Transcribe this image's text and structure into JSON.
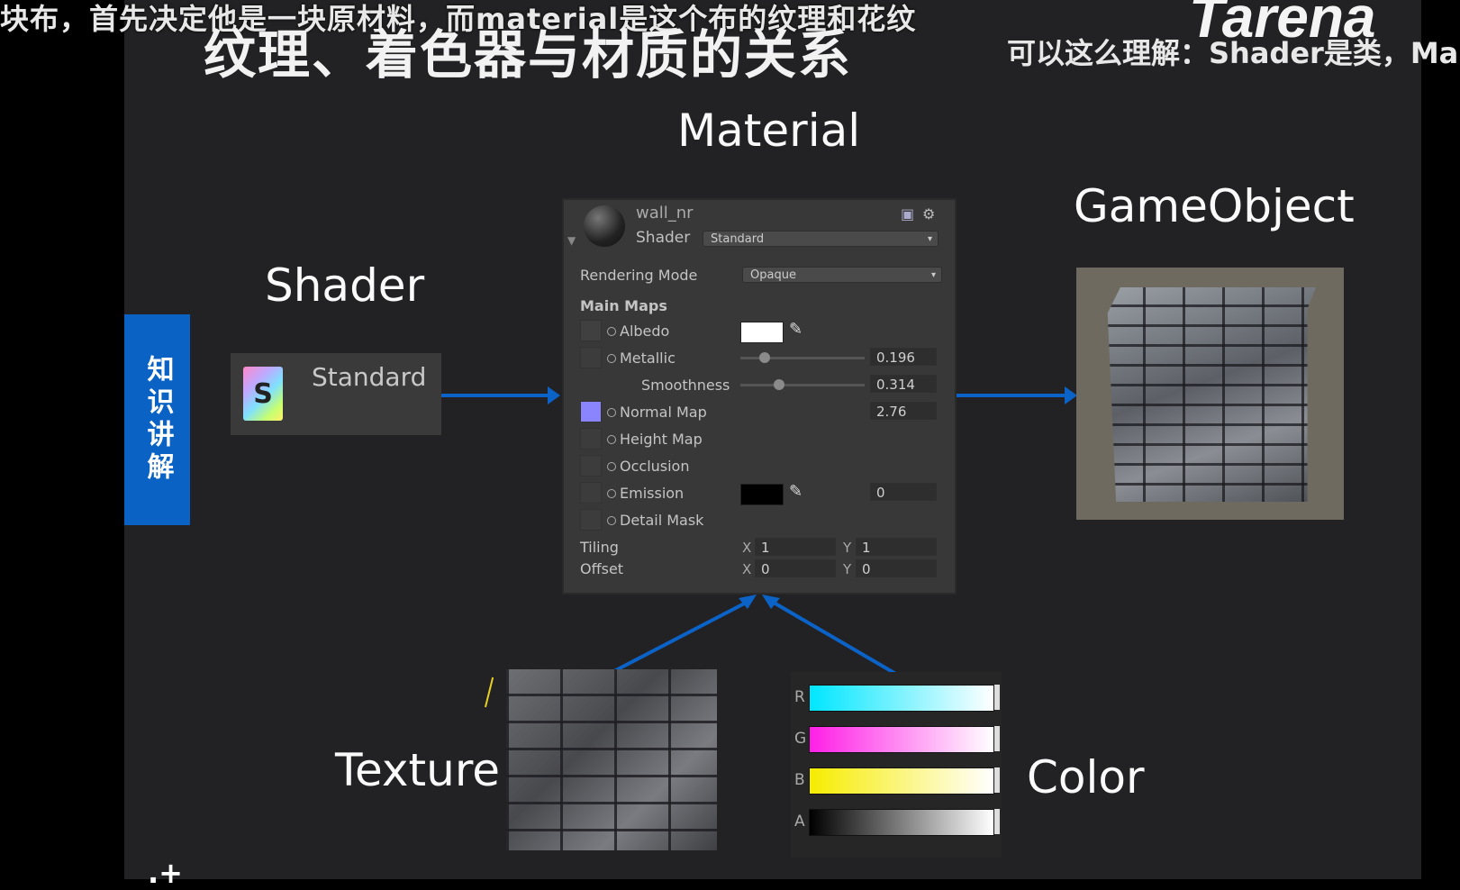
{
  "overlay": {
    "caption_top": "块布，首先决定他是一块原材料，而material是这个布的纹理和花纹",
    "caption_right": "可以这么理解：Shader是类，Ma",
    "brand": "Tarena"
  },
  "slide": {
    "title": "纹理、着色器与材质的关系",
    "side_tab": "知识讲解",
    "labels": {
      "material": "Material",
      "gameobject": "GameObject",
      "shader": "Shader",
      "texture": "Texture",
      "color": "Color"
    },
    "shader_asset": {
      "name": "Standard",
      "icon_letter": "S"
    }
  },
  "inspector": {
    "material_name": "wall_nr",
    "shader_label": "Shader",
    "shader_value": "Standard",
    "rendering_mode_label": "Rendering Mode",
    "rendering_mode_value": "Opaque",
    "main_maps_label": "Main Maps",
    "albedo_label": "Albedo",
    "metallic_label": "Metallic",
    "metallic_value": "0.196",
    "metallic_level": 0.196,
    "smoothness_label": "Smoothness",
    "smoothness_value": "0.314",
    "smoothness_level": 0.314,
    "normal_map_label": "Normal Map",
    "normal_map_value": "2.76",
    "height_map_label": "Height Map",
    "occlusion_label": "Occlusion",
    "emission_label": "Emission",
    "emission_value": "0",
    "detail_mask_label": "Detail Mask",
    "tiling_label": "Tiling",
    "offset_label": "Offset",
    "x_axis": "X",
    "y_axis": "Y",
    "tiling_x": "1",
    "tiling_y": "1",
    "offset_x": "0",
    "offset_y": "0",
    "colors": {
      "albedo": "#ffffff",
      "emission": "#000000",
      "normal_map_slot": "#8a85ff"
    }
  },
  "color_picker": {
    "channels": [
      {
        "label": "R",
        "color": "#00e6ff"
      },
      {
        "label": "G",
        "color": "#ff1fe6"
      },
      {
        "label": "B",
        "color": "#f6ec00"
      },
      {
        "label": "A",
        "color": "#000000"
      }
    ]
  },
  "accent": "#0b63c8"
}
